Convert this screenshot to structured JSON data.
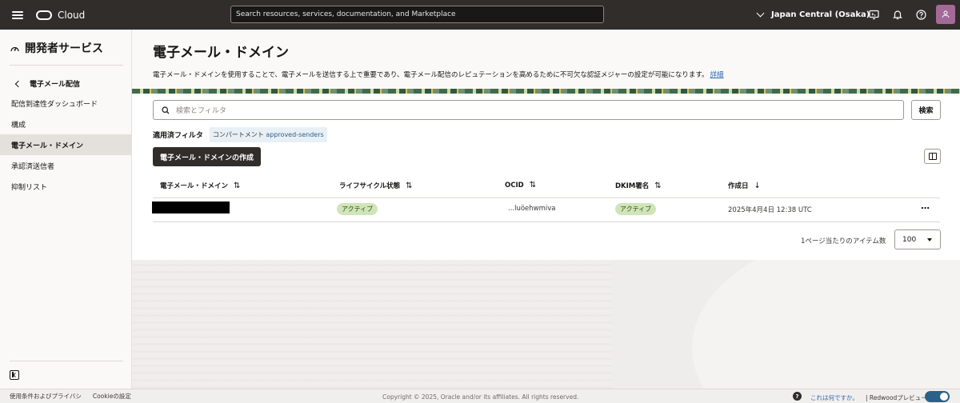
{
  "topbar": {
    "logo_text": "Cloud",
    "search_placeholder": "Search resources, services, documentation, and Marketplace",
    "region": "Japan Central (Osaka)"
  },
  "sidebar": {
    "title": "開発者サービス",
    "back_label": "電子メール配信",
    "items": [
      {
        "label": "配信到達性ダッシュボード",
        "active": false
      },
      {
        "label": "構成",
        "active": false
      },
      {
        "label": "電子メール・ドメイン",
        "active": true
      },
      {
        "label": "承認済送信者",
        "active": false
      },
      {
        "label": "抑制リスト",
        "active": false
      }
    ]
  },
  "page": {
    "title": "電子メール・ドメイン",
    "description": "電子メール・ドメインを使用することで、電子メールを送信する上で重要であり、電子メール配信のレピュテーションを高めるために不可欠な認証メジャーの設定が可能になります。",
    "details_link": "詳細"
  },
  "search": {
    "placeholder": "検索とフィルタ",
    "button": "検索"
  },
  "filters": {
    "label": "適用済フィルタ",
    "chip_prefix": "コンパートメント",
    "chip_value": "approved-senders"
  },
  "create_button": "電子メール・ドメインの作成",
  "table": {
    "columns": [
      "電子メール・ドメイン",
      "ライフサイクル状態",
      "OCID",
      "DKIM署名",
      "作成日"
    ],
    "sort_icons": [
      "⇅",
      "⇅",
      "⇅",
      "⇅",
      "↓"
    ],
    "rows": [
      {
        "domain": "",
        "lifecycle": "アクティブ",
        "ocid": "...luöehwmiva",
        "dkim": "アクティブ",
        "created": "2025年4月4日 12:38 UTC"
      }
    ],
    "row_menu": "⋯"
  },
  "pagination": {
    "label": "1ページ当たりのアイテム数",
    "value": "100"
  },
  "footer": {
    "privacy": "使用条件およびプライバシ",
    "cookie": "Cookieの設定",
    "copyright": "Copyright © 2025, Oracle and/or its affiliates. All rights reserved.",
    "help_mark": "?",
    "whats_this": "これは何ですか。",
    "redwood": "| Redwoodプレビュー"
  },
  "colors": {
    "topbar": "#312d2a",
    "accent_green_badge": "#cfe5b9",
    "toggle": "#2b6189",
    "avatar": "#a36a98"
  }
}
